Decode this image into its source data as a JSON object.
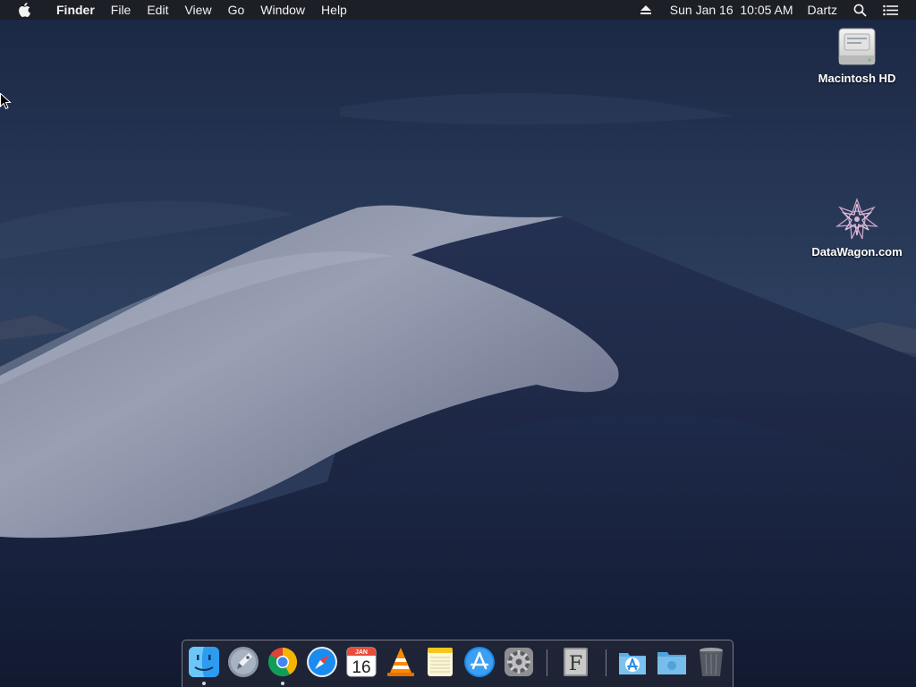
{
  "menubar": {
    "app_name": "Finder",
    "menus": [
      "File",
      "Edit",
      "View",
      "Go",
      "Window",
      "Help"
    ],
    "status": {
      "eject_icon": "eject-icon",
      "datetime": "Sun Jan 16  10:05 AM",
      "user": "Dartz",
      "search_icon": "search-icon",
      "notifications_icon": "list-icon"
    }
  },
  "desktop_icons": [
    {
      "label": "Macintosh HD",
      "icon": "hard-drive-icon"
    },
    {
      "label": "DataWagon.com",
      "icon": "datawagon-logo-icon"
    }
  ],
  "dock": {
    "items": [
      {
        "app": "Finder",
        "icon": "finder-icon",
        "running": true
      },
      {
        "app": "Launchpad",
        "icon": "launchpad-icon",
        "running": false
      },
      {
        "app": "Google Chrome",
        "icon": "chrome-icon",
        "running": true
      },
      {
        "app": "Safari",
        "icon": "safari-icon",
        "running": false
      },
      {
        "app": "Calendar",
        "icon": "calendar-icon",
        "running": false,
        "month": "JAN",
        "day": "16"
      },
      {
        "app": "VLC",
        "icon": "vlc-icon",
        "running": false
      },
      {
        "app": "Notes",
        "icon": "notes-icon",
        "running": false
      },
      {
        "app": "App Store",
        "icon": "app-store-icon",
        "running": false
      },
      {
        "app": "System Preferences",
        "icon": "system-preferences-icon",
        "running": false
      },
      {
        "app": "Font Book",
        "icon": "font-book-icon",
        "running": false,
        "glyph": "F"
      },
      {
        "app": "Applications",
        "icon": "applications-folder-icon",
        "running": false
      },
      {
        "app": "Downloads",
        "icon": "downloads-folder-icon",
        "running": false
      },
      {
        "app": "Trash",
        "icon": "trash-icon",
        "running": false
      }
    ]
  },
  "colors": {
    "menubar_bg": "#1c1e24",
    "sky_top": "#1a2744",
    "dune_light": "#9aa0b4",
    "dune_shadow": "#1b2647"
  }
}
